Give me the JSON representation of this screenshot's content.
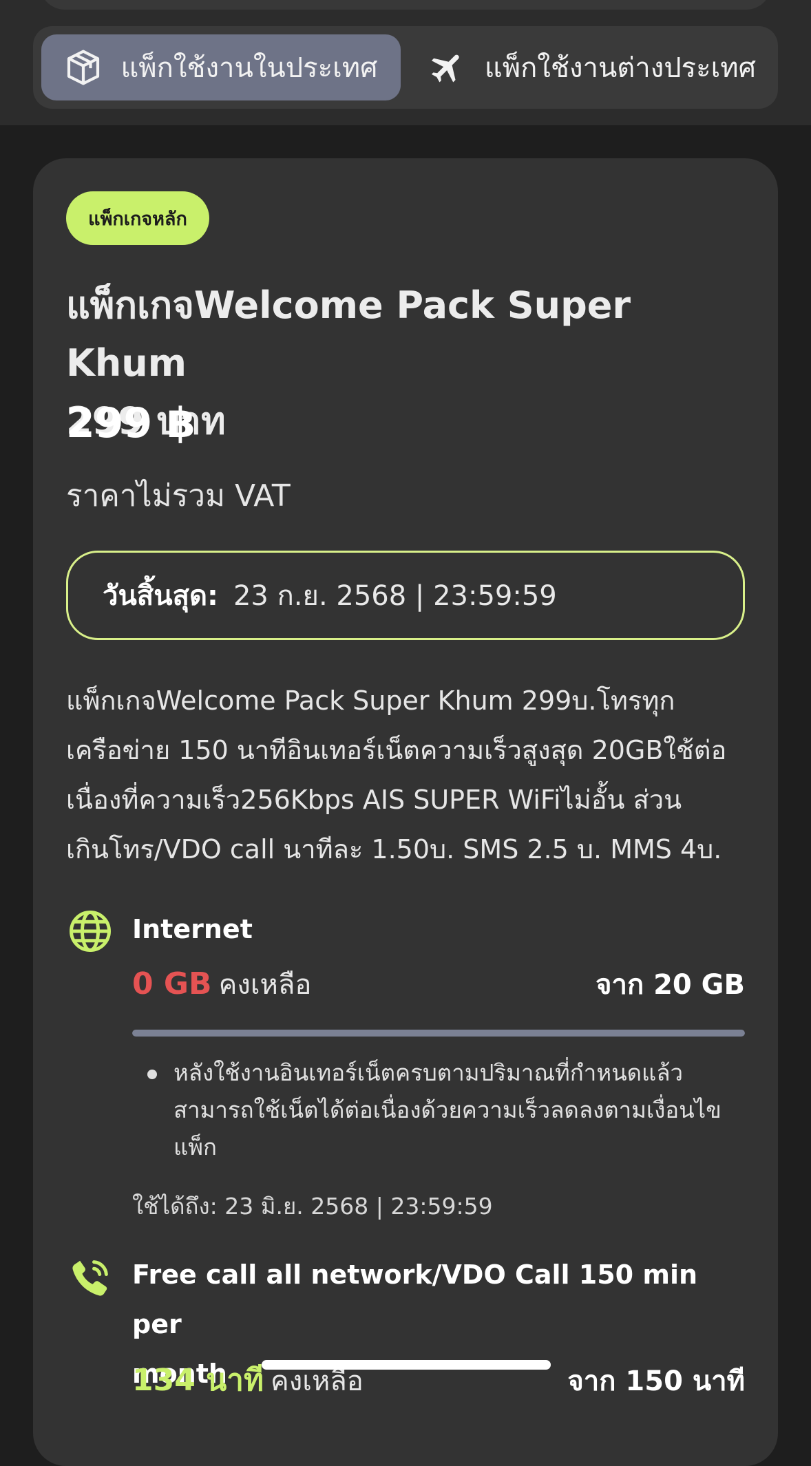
{
  "tabs": {
    "domestic_label": "แพ็กใช้งานในประเทศ",
    "international_label": "แพ็กใช้งานต่างประเทศ"
  },
  "package": {
    "badge": "แพ็กเกจหลัก",
    "title_line1": "แพ็กเกจWelcome Pack Super Khum",
    "title_line2": "299 บาท",
    "price": "299 ฿",
    "vat_note": "ราคาไม่รวม VAT",
    "expiry_label": "วันสิ้นสุด:",
    "expiry_value": "23 ก.ย. 2568 | 23:59:59",
    "description_lines": [
      "แพ็กเกจWelcome Pack Super Khum 299บ.โทรทุก",
      "เครือข่าย 150 นาทีอินเทอร์เน็ตความเร็วสูงสุด 20GBใช้ต่อ",
      "เนื่องที่ความเร็ว256Kbps AIS SUPER WiFiไม่อั้น ส่วน",
      "เกินโทร/VDO call นาทีละ 1.50บ. SMS 2.5 บ. MMS 4บ."
    ]
  },
  "internet": {
    "icon": "globe-icon",
    "title": "Internet",
    "remaining_value": "0 GB",
    "remaining_word": "คงเหลือ",
    "total": "จาก 20 GB",
    "progress_fraction": 1.0,
    "note_lines": [
      "หลังใช้งานอินเทอร์เน็ตครบตามปริมาณที่กำหนดแล้ว",
      "สามารถใช้เน็ตได้ต่อเนื่องด้วยความเร็วลดลงตามเงื่อนไข",
      "แพ็ก"
    ],
    "valid_until": "ใช้ได้ถึง: 23 มิ.ย. 2568 | 23:59:59"
  },
  "calls": {
    "icon": "phone-call-icon",
    "title_line1": "Free call all network/VDO Call 150 min per",
    "title_line2": "month",
    "remaining_value": "134 นาที",
    "remaining_word": "คงเหลือ",
    "total": "จาก 150 นาที"
  },
  "colors": {
    "accent": "#c9f06b",
    "danger": "#e55353",
    "card_bg": "#333333",
    "active_tab": "#6e7387"
  }
}
